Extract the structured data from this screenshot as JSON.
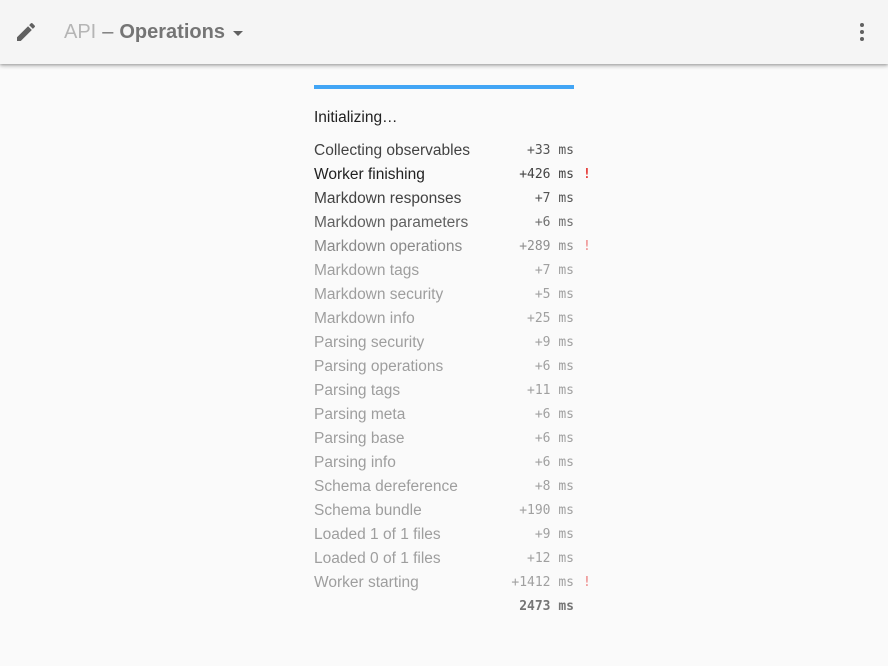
{
  "colors": {
    "toolbar_bg": "#f5f5f5",
    "page_bg": "#fafafa",
    "accent": "#42a5f5",
    "warning": "#e53935"
  },
  "toolbar": {
    "edit_icon": "pencil-icon",
    "title_api": "API",
    "title_separator": "–",
    "title_section": "Operations",
    "dropdown_icon": "caret-down-icon",
    "menu_icon": "more-vertical-icon"
  },
  "loader": {
    "progress_fraction": 1.0,
    "status": "Initializing…",
    "steps": [
      {
        "label": "Collecting observables",
        "duration": "+33 ms",
        "warning": "",
        "level": "dark"
      },
      {
        "label": "Worker finishing",
        "duration": "+426 ms",
        "warning": "!",
        "level": "darkest"
      },
      {
        "label": "Markdown responses",
        "duration": "+7 ms",
        "warning": "",
        "level": "dark"
      },
      {
        "label": "Markdown parameters",
        "duration": "+6 ms",
        "warning": "",
        "level": "mid"
      },
      {
        "label": "Markdown operations",
        "duration": "+289 ms",
        "warning": "!",
        "level": "light"
      },
      {
        "label": "Markdown tags",
        "duration": "+7 ms",
        "warning": "",
        "level": "lighter"
      },
      {
        "label": "Markdown security",
        "duration": "+5 ms",
        "warning": "",
        "level": "lighter"
      },
      {
        "label": "Markdown info",
        "duration": "+25 ms",
        "warning": "",
        "level": "lighter"
      },
      {
        "label": "Parsing security",
        "duration": "+9 ms",
        "warning": "",
        "level": "lighter"
      },
      {
        "label": "Parsing operations",
        "duration": "+6 ms",
        "warning": "",
        "level": "lighter"
      },
      {
        "label": "Parsing tags",
        "duration": "+11 ms",
        "warning": "",
        "level": "lighter"
      },
      {
        "label": "Parsing meta",
        "duration": "+6 ms",
        "warning": "",
        "level": "lighter"
      },
      {
        "label": "Parsing base",
        "duration": "+6 ms",
        "warning": "",
        "level": "lighter"
      },
      {
        "label": "Parsing info",
        "duration": "+6 ms",
        "warning": "",
        "level": "lighter"
      },
      {
        "label": "Schema dereference",
        "duration": "+8 ms",
        "warning": "",
        "level": "lighter"
      },
      {
        "label": "Schema bundle",
        "duration": "+190 ms",
        "warning": "",
        "level": "lighter"
      },
      {
        "label": "Loaded 1 of 1 files",
        "duration": "+9 ms",
        "warning": "",
        "level": "lighter"
      },
      {
        "label": "Loaded 0 of 1 files",
        "duration": "+12 ms",
        "warning": "",
        "level": "lighter"
      },
      {
        "label": "Worker starting",
        "duration": "+1412 ms",
        "warning": "!",
        "level": "lighter"
      }
    ],
    "total": "2473 ms"
  }
}
